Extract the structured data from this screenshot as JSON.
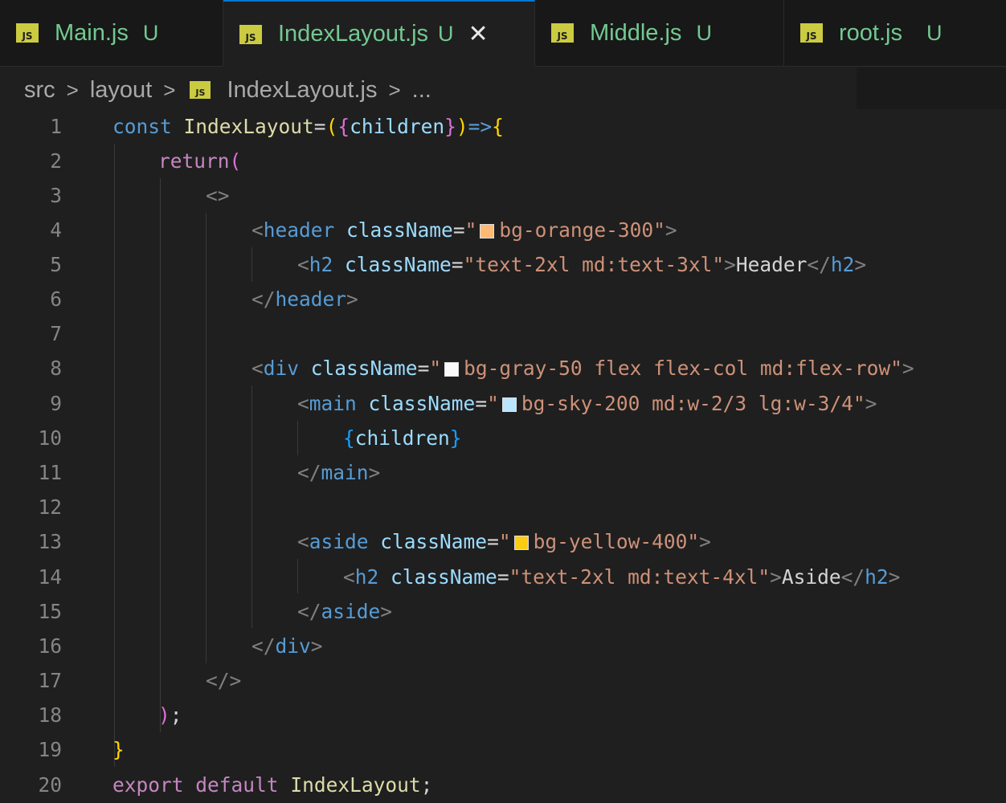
{
  "tabs": [
    {
      "label": "Main.js",
      "badge": "U"
    },
    {
      "label": "IndexLayout.js",
      "badge": "U"
    },
    {
      "label": "Middle.js",
      "badge": "U"
    },
    {
      "label": "root.js",
      "badge": "U"
    }
  ],
  "icons": {
    "js": "JS"
  },
  "breadcrumb": {
    "src": "src",
    "layout": "layout",
    "file": "IndexLayout.js",
    "more": "..."
  },
  "line_numbers": [
    "1",
    "2",
    "3",
    "4",
    "5",
    "6",
    "7",
    "8",
    "9",
    "10",
    "11",
    "12",
    "13",
    "14",
    "15",
    "16",
    "17",
    "18",
    "19",
    "20"
  ],
  "code": {
    "l1": {
      "kw": "const",
      "name": "IndexLayout",
      "eq": "=",
      "p1": "(",
      "b1": "{",
      "param": "children",
      "b2": "}",
      "p2": ")",
      "arrow": "=>",
      "b3": "{"
    },
    "l2": {
      "kw": "return",
      "p": "("
    },
    "l3": {
      "frag": "<>"
    },
    "l4": {
      "lt": "<",
      "tag": "header",
      "attr": "className",
      "eq": "=",
      "q": "\"",
      "val": "bg-orange-300\"",
      "gt": ">"
    },
    "l5": {
      "lt": "<",
      "tag": "h2",
      "attr": "className",
      "eq": "=",
      "val": "\"text-2xl md:text-3xl\"",
      "gt": ">",
      "text": "Header",
      "clt": "</",
      "ctag": "h2",
      "cgt": ">"
    },
    "l6": {
      "lt": "</",
      "tag": "header",
      "gt": ">"
    },
    "l8": {
      "lt": "<",
      "tag": "div",
      "attr": "className",
      "eq": "=",
      "q": "\"",
      "val": "bg-gray-50 flex flex-col md:flex-row\"",
      "gt": ">"
    },
    "l9": {
      "lt": "<",
      "tag": "main",
      "attr": "className",
      "eq": "=",
      "q": "\"",
      "val": "bg-sky-200 md:w-2/3 lg:w-3/4\"",
      "gt": ">"
    },
    "l10": {
      "b1": "{",
      "expr": "children",
      "b2": "}"
    },
    "l11": {
      "lt": "</",
      "tag": "main",
      "gt": ">"
    },
    "l13": {
      "lt": "<",
      "tag": "aside",
      "attr": "className",
      "eq": "=",
      "q": "\"",
      "val": "bg-yellow-400\"",
      "gt": ">"
    },
    "l14": {
      "lt": "<",
      "tag": "h2",
      "attr": "className",
      "eq": "=",
      "val": "\"text-2xl md:text-4xl\"",
      "gt": ">",
      "text": "Aside",
      "clt": "</",
      "ctag": "h2",
      "cgt": ">"
    },
    "l15": {
      "lt": "</",
      "tag": "aside",
      "gt": ">"
    },
    "l16": {
      "lt": "</",
      "tag": "div",
      "gt": ">"
    },
    "l17": {
      "frag": "</>"
    },
    "l18": {
      "p": ")",
      "semi": ";"
    },
    "l19": {
      "b": "}"
    },
    "l20": {
      "kw1": "export",
      "kw2": "default",
      "name": "IndexLayout",
      "semi": ";"
    }
  },
  "swatches": {
    "orange": "#fdba74",
    "gray": "#f9fafb",
    "sky": "#bae6fd",
    "yellow": "#facc15"
  }
}
